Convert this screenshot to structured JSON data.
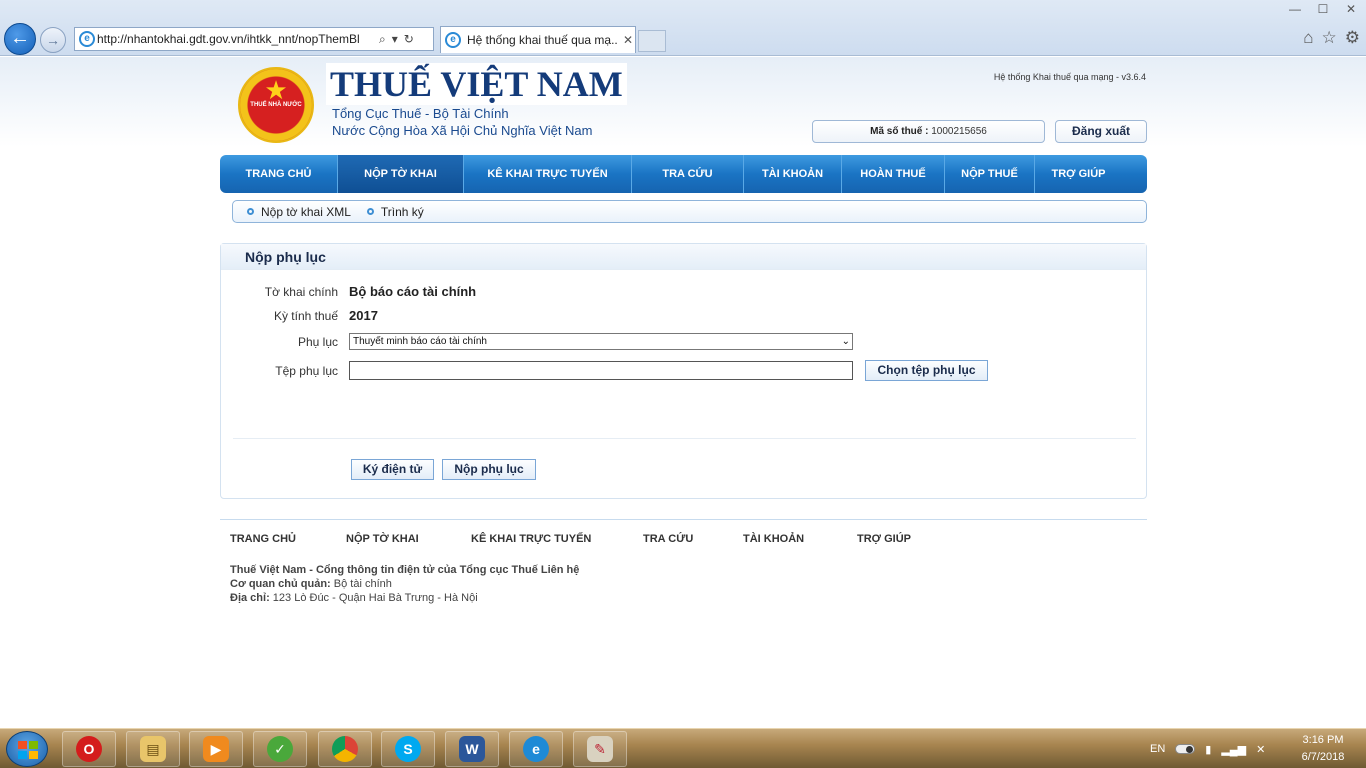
{
  "browser": {
    "url": "http://nhantokhai.gdt.gov.vn/ihtkk_nnt/nopThemBl",
    "tab_title": "Hệ thống khai thuế qua mạ..."
  },
  "header": {
    "logo_text": "THUẾ NHÀ NƯỚC",
    "brand": "THUẾ VIỆT NAM",
    "sub1": "Tổng Cục Thuế - Bộ Tài Chính",
    "sub2": "Nước Cộng Hòa Xã Hội Chủ Nghĩa Việt Nam",
    "version": "Hệ thống Khai thuế qua mạng - v3.6.4",
    "tax_label": "Mã số thuế :",
    "tax_code": "1000215656",
    "logout": "Đăng xuất"
  },
  "nav": {
    "items": [
      "TRANG CHỦ",
      "NỘP TỜ KHAI",
      "KÊ KHAI TRỰC TUYẾN",
      "TRA CỨU",
      "TÀI KHOẢN",
      "HOÀN THUẾ",
      "NỘP THUẾ",
      "TRỢ GIÚP"
    ],
    "active": "NỘP TỜ KHAI"
  },
  "subnav": {
    "items": [
      "Nộp tờ khai XML",
      "Trình ký"
    ]
  },
  "panel": {
    "title": "Nộp phụ lục",
    "main_form_label": "Tờ khai chính",
    "main_form_value": "Bộ báo cáo tài chính",
    "period_label": "Kỳ tính thuế",
    "period_value": "2017",
    "appendix_label": "Phụ lục",
    "appendix_selected": "Thuyết minh báo cáo tài chính",
    "file_label": "Tệp phụ lục",
    "file_value": "",
    "choose_button": "Chọn tệp phụ lục",
    "sign_button": "Ký điện tử",
    "submit_button": "Nộp phụ lục"
  },
  "footer": {
    "nav": [
      "TRANG CHỦ",
      "NỘP TỜ KHAI",
      "KÊ KHAI TRỰC TUYẾN",
      "TRA CỨU",
      "TÀI KHOẢN",
      "TRỢ GIÚP"
    ],
    "line1": "Thuế Việt Nam - Cổng thông tin điện tử của Tổng cục Thuế Liên hệ",
    "agency_label": "Cơ quan chủ quản:",
    "agency_value": "Bộ tài chính",
    "address_label": "Địa chỉ:",
    "address_value": "123 Lò Đúc - Quận Hai Bà Trưng - Hà Nội"
  },
  "taskbar": {
    "language": "EN",
    "time": "3:16 PM",
    "date": "6/7/2018",
    "apps": [
      "opera-icon",
      "file-explorer-icon",
      "media-player-icon",
      "coccoc-icon",
      "chrome-icon",
      "skype-icon",
      "word-icon",
      "internet-explorer-icon",
      "paint-icon"
    ]
  }
}
